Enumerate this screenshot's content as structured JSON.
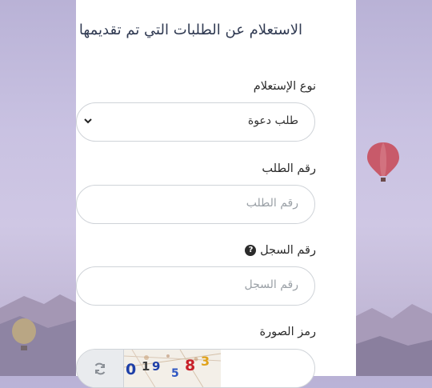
{
  "form": {
    "title": "الاستعلام عن الطلبات التي تم تقديمها",
    "inquiry_type": {
      "label": "نوع الإستعلام",
      "selected": "طلب دعوة"
    },
    "request_number": {
      "label": "رقم الطلب",
      "placeholder": "رقم الطلب"
    },
    "record_number": {
      "label": "رقم السجل",
      "placeholder": "رقم السجل",
      "help_icon": "question-circle-icon"
    },
    "captcha": {
      "label": "رمز الصورة",
      "refresh_icon": "refresh-icon",
      "code_chars": [
        {
          "ch": "0",
          "color": "#1e3fa8"
        },
        {
          "ch": "1",
          "color": "#3b3b3b"
        },
        {
          "ch": "9",
          "color": "#1e3fa8"
        },
        {
          "ch": "5",
          "color": "#2f57c2"
        },
        {
          "ch": "8",
          "color": "#c8202a"
        },
        {
          "ch": "3",
          "color": "#e0a21b"
        }
      ]
    }
  },
  "colors": {
    "card": "#ffffff",
    "border": "#cfd3d8",
    "title_text": "#303a52",
    "background_sky": "#c9c2e2",
    "balloon": "#c85a6a"
  }
}
